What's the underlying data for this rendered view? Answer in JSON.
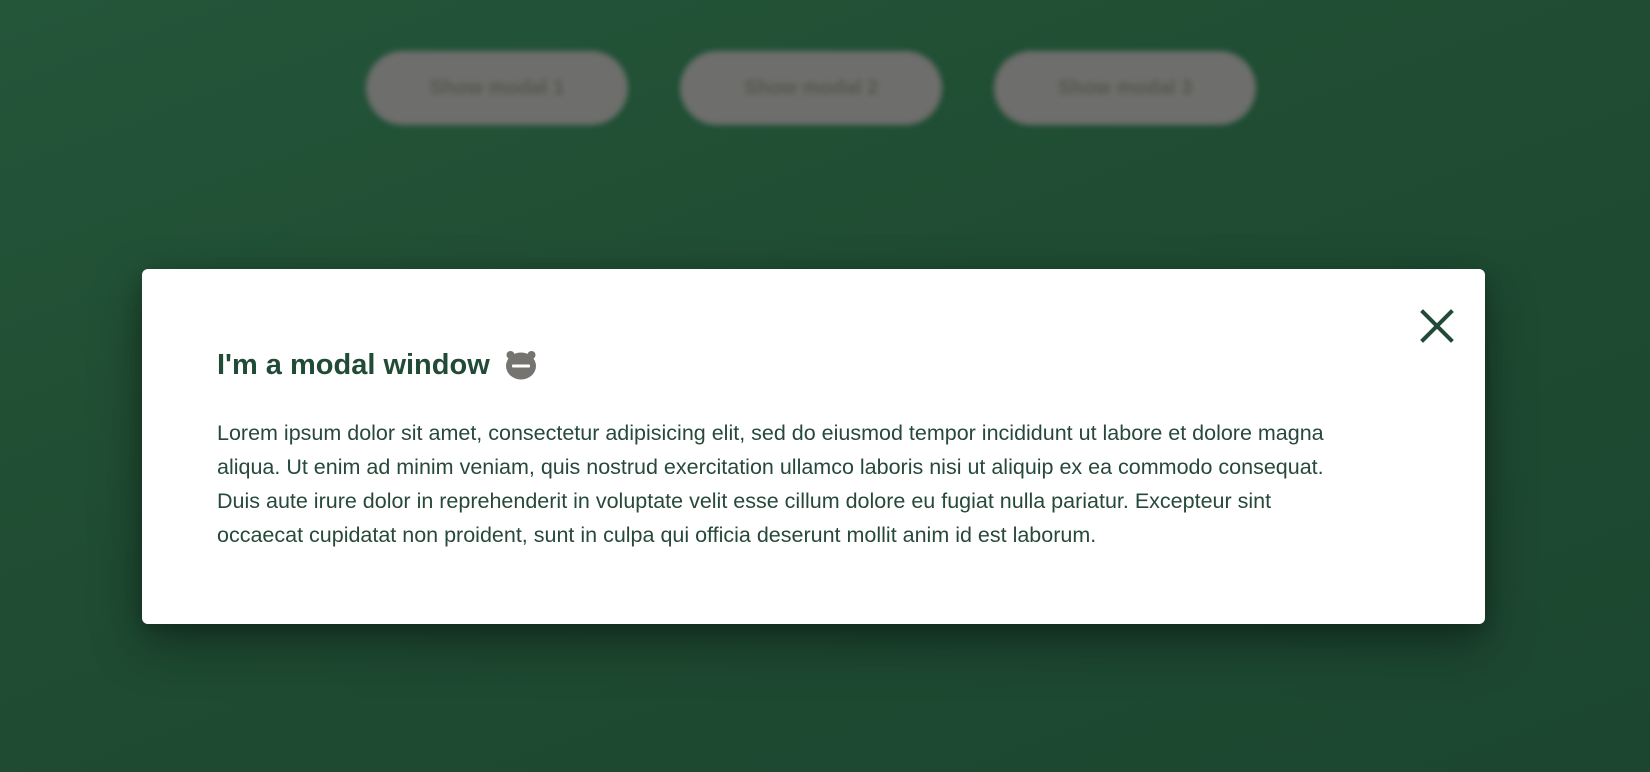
{
  "buttons": [
    {
      "label": "Show modal 1"
    },
    {
      "label": "Show modal 2"
    },
    {
      "label": "Show modal 3"
    }
  ],
  "modal": {
    "title": "I'm a modal window",
    "title_icon": "expressionless-face-icon",
    "body": "Lorem ipsum dolor sit amet, consectetur adipisicing elit, sed do eiusmod tempor incididunt ut labore et dolore magna aliqua. Ut enim ad minim veniam, quis nostrud exercitation ullamco laboris nisi ut aliquip ex ea commodo consequat. Duis aute irure dolor in reprehenderit in voluptate velit esse cillum dolore eu fugiat nulla pariatur. Excepteur sint occaecat cupidatat non proident, sunt in culpa qui officia deserunt mollit anim id est laborum.",
    "close_icon": "close-icon"
  },
  "colors": {
    "background": "#204d33",
    "accent": "#214a37",
    "button": "#6e6e6c",
    "modal_bg": "#ffffff"
  }
}
